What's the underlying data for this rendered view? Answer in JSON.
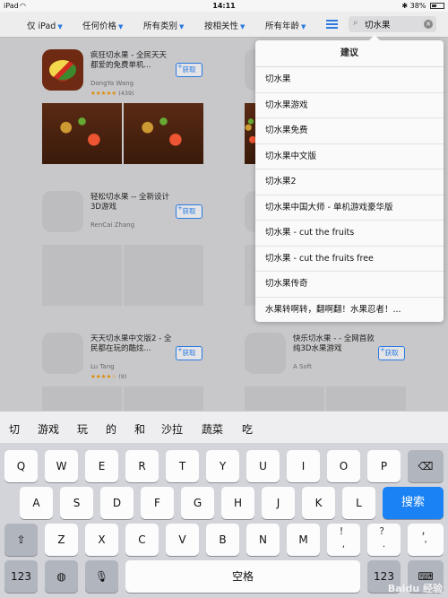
{
  "status_bar": {
    "device": "iPad",
    "time": "14:11",
    "battery": "38%"
  },
  "filters": {
    "device": "仅 iPad",
    "price": "任何价格",
    "category": "所有类别",
    "sort": "按相关性",
    "age": "所有年龄"
  },
  "search": {
    "query": "切水果"
  },
  "apps": [
    {
      "name": "疯狂切水果 - 全民天天都爱的免费单机...",
      "developer": "DongYa Wang",
      "rating": "★★★★★",
      "reviews": "(439)",
      "get": "获取"
    },
    {
      "name": "轻松切水果 -- 全新设计3D游戏",
      "developer": "RenCai Zhang",
      "get": "获取"
    },
    {
      "name": "天天切水果中文版2 - 全民都在玩的酷炫...",
      "developer": "Lu Tang",
      "rating": "★★★★☆",
      "reviews": "(9)",
      "get": "获取"
    },
    {
      "name": "快乐切水果 - - 全网首款纯3D水果游戏",
      "developer": "A Soft",
      "get": "获取"
    }
  ],
  "suggestions": {
    "title": "建议",
    "items": [
      "切水果",
      "切水果游戏",
      "切水果免费",
      "切水果中文版",
      "切水果2",
      "切水果中国大师 - 单机游戏豪华版",
      "切水果 - cut the fruits",
      "切水果 - cut the fruits free",
      "切水果传奇",
      "水果转啊转，翻啊翻！水果忍者！..."
    ]
  },
  "candidates": [
    "切",
    "游戏",
    "玩",
    "的",
    "和",
    "沙拉",
    "蔬菜",
    "吃"
  ],
  "keyboard": {
    "row1": [
      "Q",
      "W",
      "E",
      "R",
      "T",
      "Y",
      "U",
      "I",
      "O",
      "P"
    ],
    "row2": [
      "A",
      "S",
      "D",
      "F",
      "G",
      "H",
      "J",
      "K",
      "L"
    ],
    "row3": [
      "Z",
      "X",
      "C",
      "V",
      "B",
      "N",
      "M"
    ],
    "punct": [
      "！\n,",
      "？\n.",
      "，\n'"
    ],
    "search_label": "搜索",
    "space_label": "空格",
    "numbers_label": "123"
  },
  "watermark": "Baidu 经验"
}
